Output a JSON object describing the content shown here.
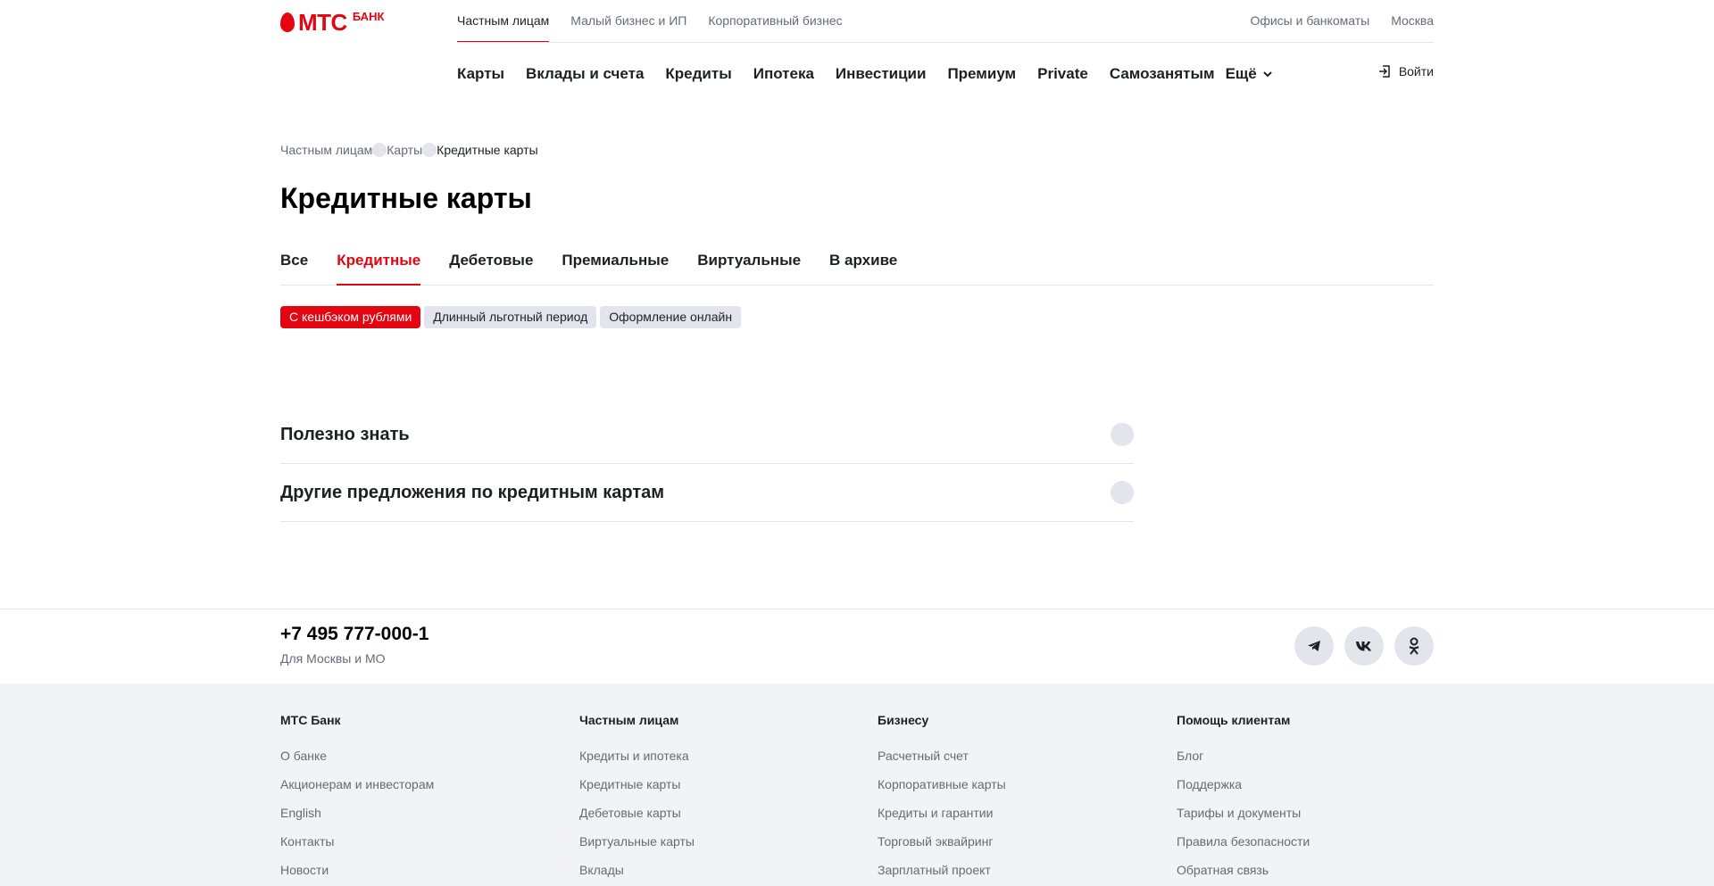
{
  "logo": {
    "text": "МТС",
    "sub": "БАНК"
  },
  "segments": [
    "Частным лицам",
    "Малый бизнес и ИП",
    "Корпоративный бизнес"
  ],
  "top_right": {
    "offices": "Офисы и банкоматы",
    "city": "Москва"
  },
  "main_nav": [
    "Карты",
    "Вклады и счета",
    "Кредиты",
    "Ипотека",
    "Инвестиции",
    "Премиум",
    "Private",
    "Самозанятым"
  ],
  "more_label": "Ещё",
  "login_label": "Войти",
  "breadcrumb": [
    "Частным лицам",
    "Карты",
    "Кредитные карты"
  ],
  "page_title": "Кредитные карты",
  "tabs": [
    "Все",
    "Кредитные",
    "Дебетовые",
    "Премиальные",
    "Виртуальные",
    "В архиве"
  ],
  "active_tab": "Кредитные",
  "chips": [
    "С кешбэком рублями",
    "Длинный льготный период",
    "Оформление онлайн"
  ],
  "accordion": [
    "Полезно знать",
    "Другие предложения по кредитным картам"
  ],
  "footer_contact": {
    "phone": "+7 495 777-000-1",
    "phone_note": "Для Москвы и МО"
  },
  "footer_columns": [
    {
      "title": "МТС Банк",
      "links": [
        "О банке",
        "Акционерам и инвесторам",
        "English",
        "Контакты",
        "Новости"
      ]
    },
    {
      "title": "Частным лицам",
      "links": [
        "Кредиты и ипотека",
        "Кредитные карты",
        "Дебетовые карты",
        "Виртуальные карты",
        "Вклады"
      ]
    },
    {
      "title": "Бизнесу",
      "links": [
        "Расчетный счет",
        "Корпоративные карты",
        "Кредиты и гарантии",
        "Торговый эквайринг",
        "Зарплатный проект"
      ]
    },
    {
      "title": "Помощь клиентам",
      "links": [
        "Блог",
        "Поддержка",
        "Тарифы и документы",
        "Правила безопасности",
        "Обратная связь"
      ]
    }
  ],
  "colors": {
    "brand": "#e30611",
    "muted": "#626c77",
    "divider": "#e2e5eb",
    "footer_bg": "#f2f3f7"
  }
}
